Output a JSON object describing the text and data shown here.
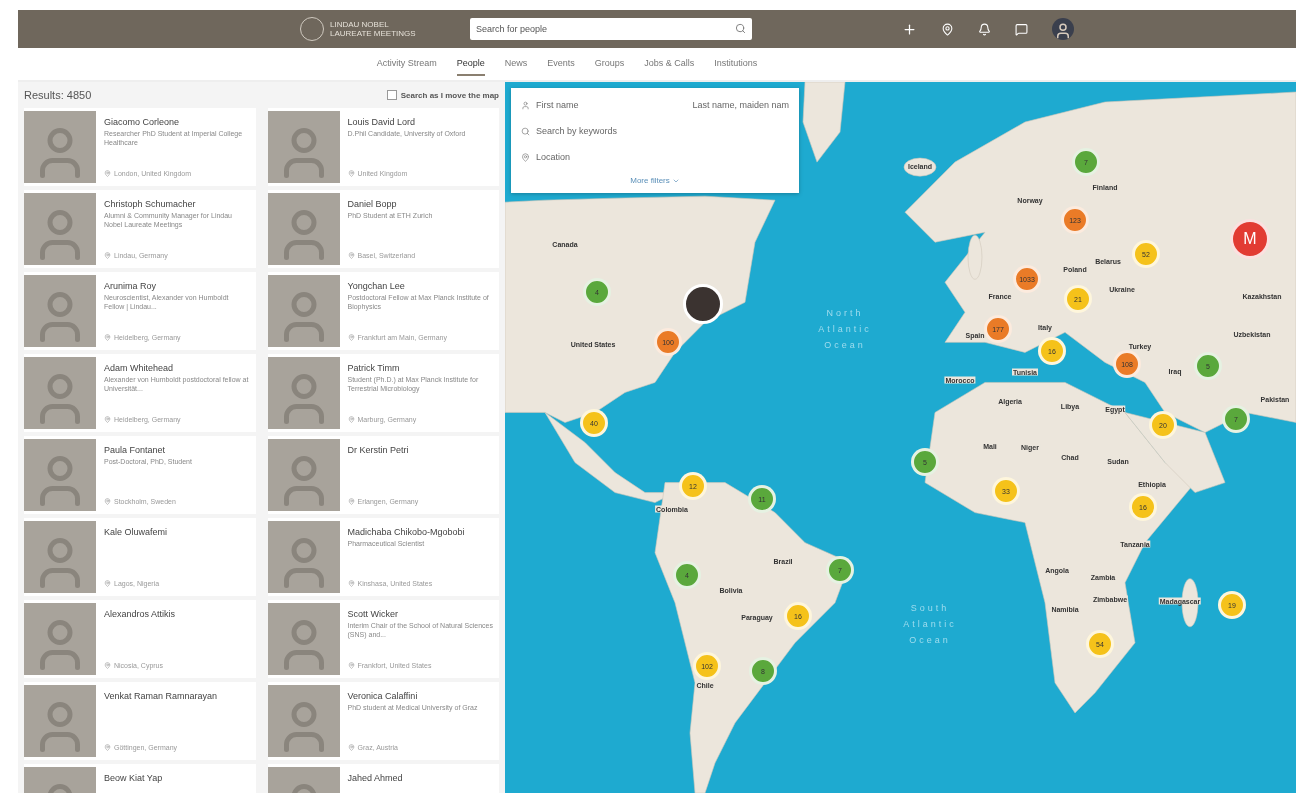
{
  "header": {
    "logo_text": "LINDAU NOBEL LAUREATE MEETINGS",
    "search": {
      "placeholder": "Search for people"
    }
  },
  "nav": [
    {
      "label": "Activity Stream",
      "selected": false
    },
    {
      "label": "People",
      "selected": true
    },
    {
      "label": "News",
      "selected": false
    },
    {
      "label": "Events",
      "selected": false
    },
    {
      "label": "Groups",
      "selected": false
    },
    {
      "label": "Jobs & Calls",
      "selected": false
    },
    {
      "label": "Institutions",
      "selected": false
    }
  ],
  "results": {
    "count": "Results: 4850",
    "map_toggle": {
      "label": "Search as I move the map",
      "checked": false
    }
  },
  "people": [
    {
      "name": "Giacomo Corleone",
      "role": "Researcher PhD Student at Imperial College Healthcare",
      "location": "London, United Kingdom"
    },
    {
      "name": "Louis David Lord",
      "role": "D.Phil Candidate, University of Oxford",
      "location": "United Kingdom"
    },
    {
      "name": "Christoph Schumacher",
      "role": "Alumni & Community Manager for Lindau Nobel Laureate Meetings",
      "location": "Lindau, Germany"
    },
    {
      "name": "Daniel Bopp",
      "role": "PhD Student at ETH Zurich",
      "location": "Basel, Switzerland"
    },
    {
      "name": "Arunima Roy",
      "role": "Neuroscientist, Alexander von Humboldt Fellow | Lindau...",
      "location": "Heidelberg, Germany"
    },
    {
      "name": "Yongchan Lee",
      "role": "Postdoctoral Fellow at Max Planck Institute of Biophysics",
      "location": "Frankfurt am Main, Germany"
    },
    {
      "name": "Adam Whitehead",
      "role": "Alexander von Humboldt postdoctoral fellow at Universität...",
      "location": "Heidelberg, Germany"
    },
    {
      "name": "Patrick Timm",
      "role": "Student (Ph.D.) at Max Planck Institute for Terrestrial Microbiology",
      "location": "Marburg, Germany"
    },
    {
      "name": "Paula Fontanet",
      "role": "Post-Doctoral, PhD, Student",
      "location": "Stockholm, Sweden"
    },
    {
      "name": "Dr Kerstin Petri",
      "location": "Erlangen, Germany"
    },
    {
      "name": "Kale Oluwafemi",
      "location": "Lagos, Nigeria"
    },
    {
      "name": "Madichaba Chikobo-Mgobobi",
      "role": "Pharmaceutical Scientist",
      "location": "Kinshasa, United States"
    },
    {
      "name": "Alexandros Attikis",
      "location": "Nicosia, Cyprus"
    },
    {
      "name": "Scott Wicker",
      "role": "Interim Chair of the School of Natural Sciences (SNS) and...",
      "location": "Frankfort, United States"
    },
    {
      "name": "Venkat Raman Ramnarayan",
      "location": "Göttingen, Germany"
    },
    {
      "name": "Veronica Calaffini",
      "role": "PhD student at Medical University of Graz",
      "location": "Graz, Austria"
    },
    {
      "name": "Beow Kiat Yap"
    },
    {
      "name": "Jahed Ahmed"
    }
  ],
  "filters": {
    "first_name": {
      "placeholder": "First name"
    },
    "last_name": {
      "placeholder": "Last name, maiden nam"
    },
    "keywords": {
      "placeholder": "Search by keywords"
    },
    "location": {
      "placeholder": "Location"
    },
    "more_link": "More filters"
  },
  "map": {
    "oceans": [
      "North Atlantic Ocean",
      "South Atlantic Ocean"
    ],
    "countries": [
      "Canada",
      "United States",
      "Brazil",
      "Bolivia",
      "Paraguay",
      "Colombia",
      "Chile",
      "Iceland",
      "Finland",
      "Norway",
      "Poland",
      "Belarus",
      "Ukraine",
      "France",
      "Spain",
      "Italy",
      "Turkey",
      "Algeria",
      "Libya",
      "Egypt",
      "Mali",
      "Niger",
      "Chad",
      "Sudan",
      "Kazakhstan",
      "Uzbekistan",
      "Iraq",
      "Pakistan",
      "Morocco",
      "Ethiopia",
      "Tanzania",
      "Angola",
      "Zambia",
      "Zimbabwe",
      "Namibia",
      "Madagascar",
      "Tunisia"
    ],
    "markers": [
      {
        "kind": "count",
        "count": "4",
        "color": "#5aa83c"
      },
      {
        "kind": "count",
        "count": "100",
        "color": "#ea7b27"
      },
      {
        "kind": "photo"
      },
      {
        "kind": "count",
        "count": "7",
        "color": "#5aa83c"
      },
      {
        "kind": "count",
        "count": "123",
        "color": "#ea7b27"
      },
      {
        "kind": "count",
        "count": "52",
        "color": "#f5c21a"
      },
      {
        "kind": "count",
        "count": "M",
        "color": "#e23b33"
      },
      {
        "kind": "count",
        "count": "1033",
        "color": "#ea7b27"
      },
      {
        "kind": "count",
        "count": "21",
        "color": "#f5c21a"
      },
      {
        "kind": "count",
        "count": "177",
        "color": "#ea7b27"
      },
      {
        "kind": "count",
        "count": "16",
        "color": "#f5c21a"
      },
      {
        "kind": "count",
        "count": "108",
        "color": "#ea7b27"
      },
      {
        "kind": "count",
        "count": "5",
        "color": "#5aa83c"
      },
      {
        "kind": "count",
        "count": "7",
        "color": "#5aa83c"
      },
      {
        "kind": "count",
        "count": "20",
        "color": "#f5c21a"
      },
      {
        "kind": "count",
        "count": "40",
        "color": "#f5c21a"
      },
      {
        "kind": "count",
        "count": "12",
        "color": "#f5c21a"
      },
      {
        "kind": "count",
        "count": "11",
        "color": "#5aa83c"
      },
      {
        "kind": "count",
        "count": "4",
        "color": "#5aa83c"
      },
      {
        "kind": "count",
        "count": "7",
        "color": "#5aa83c"
      },
      {
        "kind": "count",
        "count": "16",
        "color": "#f5c21a"
      },
      {
        "kind": "count",
        "count": "102",
        "color": "#f5c21a"
      },
      {
        "kind": "count",
        "count": "8",
        "color": "#5aa83c"
      },
      {
        "kind": "count",
        "count": "5",
        "color": "#5aa83c"
      },
      {
        "kind": "count",
        "count": "33",
        "color": "#f5c21a"
      },
      {
        "kind": "count",
        "count": "16",
        "color": "#f5c21a"
      },
      {
        "kind": "count",
        "count": "19",
        "color": "#f5c21a"
      },
      {
        "kind": "count",
        "count": "54",
        "color": "#f5c21a"
      }
    ]
  }
}
